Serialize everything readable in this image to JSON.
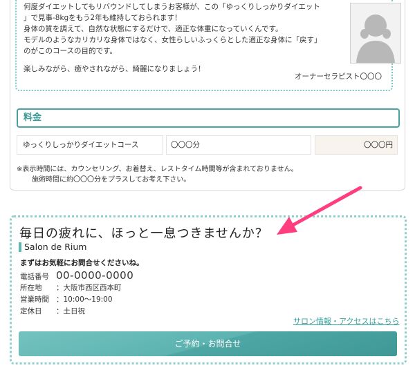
{
  "message": {
    "lines": [
      "何度ダイエットしてもリバウンドしてしまうお客様が、この「ゆっくりしっかりダイエット",
      "」で見事-8kgをもう2年も維持しておられます！",
      "身体の質を調えて、自然な状態にするだけで、適正な体重になっていくんです。",
      "モデルのようなカリカリな身体ではなく、女性らしいふっくらとした適正な身体に「戻す」",
      "のがこのコースの目的です。",
      "楽しみながら、癒やされながら、綺麗になりましょう！"
    ],
    "signature": "オーナーセラピスト〇〇〇"
  },
  "price": {
    "heading": "料金",
    "course": "ゆっくりしっかりダイエットコース",
    "duration": "〇〇〇分",
    "amount": "〇〇〇円",
    "note1": "※表示時間には、カウンセリング、お着替え、レストタイム時間等が含まれておりません。",
    "note2": "施術時間に約〇〇〇分をプラスしてお考え下さい。"
  },
  "salon": {
    "catch": "毎日の疲れに、ほっと一息つきませんか？",
    "name": "Salon de Rium",
    "invite": "まずはお気軽にお問合せくださいね。",
    "tel_label": "電話番号",
    "tel": "00-0000-0000",
    "address_label": "所在地",
    "address": "：大阪市西区西本町",
    "hours_label": "営業時間",
    "hours": "：10:00〜19:00",
    "closed_label": "定休日",
    "closed": "：土日祝",
    "access_link": "サロン情報・アクセスはこちら",
    "cta": "ご予約・お問合せ"
  },
  "colors": {
    "accent": "#4aa19f",
    "dotted_border": "#8fd0cd",
    "link": "#3aa3a0",
    "arrow": "#ff3d7f",
    "price_cell_bg": "#f8f3ec"
  }
}
